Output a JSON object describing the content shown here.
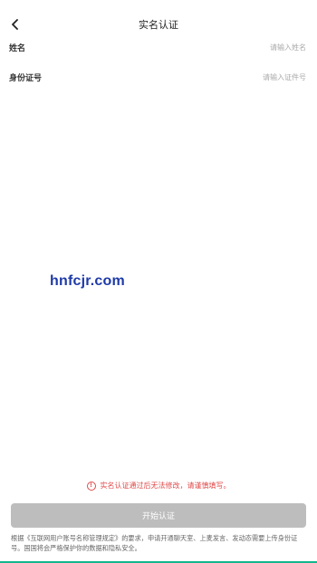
{
  "header": {
    "title": "实名认证",
    "back_icon": "chevron-left-icon"
  },
  "form": {
    "name": {
      "label": "姓名",
      "placeholder": "请输入姓名",
      "value": ""
    },
    "id_number": {
      "label": "身份证号",
      "placeholder": "请输入证件号",
      "value": ""
    }
  },
  "watermark": "hnfcjr.com",
  "warning": {
    "icon": "exclamation-circle-icon",
    "text": "实名认证通过后无法修改，请谨慎填写。"
  },
  "start_button": {
    "label": "开始认证"
  },
  "notice_text": "根据《互联网用户账号名称管理规定》的要求，申请开通聊天室、上麦发言、发动态需要上传身份证号。国国将会严格保护你的数据和隐私安全。",
  "colors": {
    "warning": "#e04a4a",
    "button_disabled": "#bdbdbd",
    "watermark": "#1e3aa8",
    "accent": "#14b58c"
  }
}
